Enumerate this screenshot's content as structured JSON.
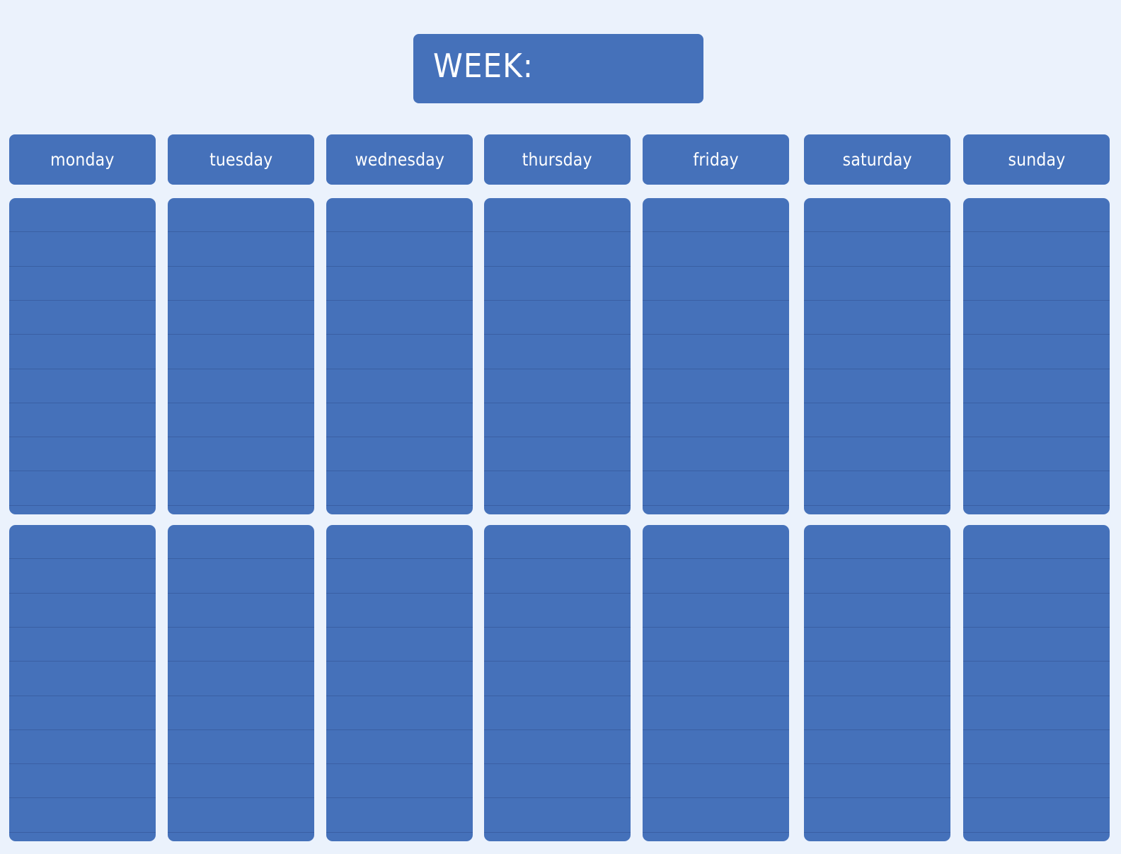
{
  "header": {
    "week_label": "WEEK:",
    "week_value": ""
  },
  "days": [
    {
      "label": "monday"
    },
    {
      "label": "tuesday"
    },
    {
      "label": "wednesday"
    },
    {
      "label": "thursday"
    },
    {
      "label": "friday"
    },
    {
      "label": "saturday"
    },
    {
      "label": "sunday"
    }
  ],
  "sections_per_day": 2,
  "lines_per_section": 9,
  "colors": {
    "background": "#ebf2fc",
    "box": "#4571ba",
    "rule_line": "#3a5fa3",
    "text": "#ffffff"
  }
}
